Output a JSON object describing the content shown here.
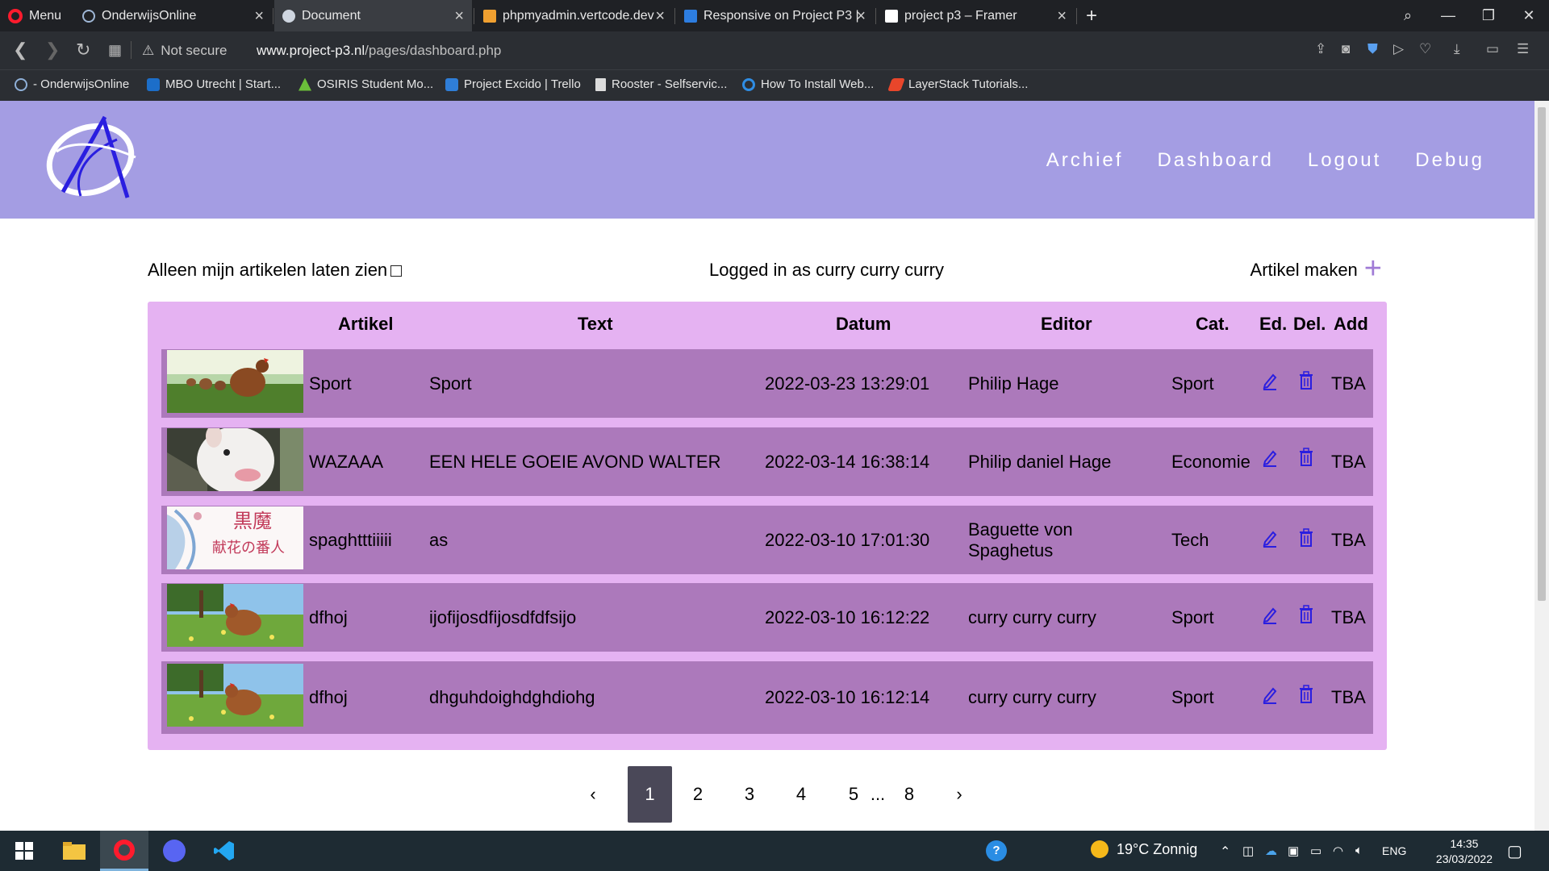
{
  "browser": {
    "menu_label": "Menu",
    "tabs": [
      {
        "title": "OnderwijsOnline",
        "favicon_color": "#9fb7d6"
      },
      {
        "title": "Document",
        "favicon_color": "#cfd6e0"
      },
      {
        "title": "phpmyadmin.vertcode.dev",
        "favicon_color": "#f0a030"
      },
      {
        "title": "Responsive on Project P3 |",
        "favicon_color": "#2d7de0"
      },
      {
        "title": "project p3 – Framer",
        "favicon_color": "#ffffff"
      }
    ],
    "new_tab": "+",
    "security_label": "Not secure",
    "url_host": "www.project-p3.nl",
    "url_path": "/pages/dashboard.php",
    "bookmarks": [
      {
        "label": "- OnderwijsOnline",
        "color": "#8fb0d8"
      },
      {
        "label": "MBO Utrecht | Start...",
        "color": "#1c6ec9"
      },
      {
        "label": "OSIRIS Student Mo...",
        "color": "#6bbf3a"
      },
      {
        "label": "Project Excido | Trello",
        "color": "#2f7ed8"
      },
      {
        "label": "Rooster - Selfservic...",
        "color": "#dcdcdc"
      },
      {
        "label": "How To Install Web...",
        "color": "#2f8de4"
      },
      {
        "label": "LayerStack Tutorials...",
        "color": "#e8462b"
      }
    ]
  },
  "site": {
    "nav": [
      "Archief",
      "Dashboard",
      "Logout",
      "Debug"
    ],
    "filter_label": "Alleen mijn artikelen laten zien",
    "logged_in": "Logged in as curry curry curry",
    "create_label": "Artikel maken",
    "create_icon": "plus-icon",
    "columns": {
      "artikel": "Artikel",
      "text": "Text",
      "datum": "Datum",
      "editor": "Editor",
      "cat": "Cat.",
      "ed": "Ed.",
      "del": "Del.",
      "add": "Add"
    },
    "rows": [
      {
        "image": "chickens-field",
        "artikel": "Sport",
        "text": "Sport",
        "datum": "2022-03-23 13:29:01",
        "editor": "Philip Hage",
        "cat": "Sport",
        "add": "TBA"
      },
      {
        "image": "bull-terrier",
        "artikel": "WAZAAA",
        "text": "EEN HELE GOEIE AVOND WALTER",
        "datum": "2022-03-14 16:38:14",
        "editor": "Philip daniel Hage",
        "cat": "Economie",
        "add": "TBA"
      },
      {
        "image": "anime-banner",
        "artikel": "spaghtttiiiii",
        "text": "as",
        "datum": "2022-03-10 17:01:30",
        "editor": "Baguette von Spaghetus",
        "cat": "Tech",
        "add": "TBA"
      },
      {
        "image": "hen-meadow",
        "artikel": "dfhoj",
        "text": "ijofijosdfijosdfdfsijo",
        "datum": "2022-03-10 16:12:22",
        "editor": "curry curry curry",
        "cat": "Sport",
        "add": "TBA"
      },
      {
        "image": "hen-meadow",
        "artikel": "dfhoj",
        "text": "dhguhdoighdghdiohg",
        "datum": "2022-03-10 16:12:14",
        "editor": "curry curry curry",
        "cat": "Sport",
        "add": "TBA"
      }
    ],
    "anime_banner_text": [
      "黒魔",
      "献花の番人"
    ],
    "pagination": {
      "prev": "‹",
      "pages": [
        "1",
        "2",
        "3",
        "4",
        "5"
      ],
      "ellipsis": "...",
      "last": "8",
      "next": "›",
      "current": "1"
    }
  },
  "taskbar": {
    "weather": "19°C  Zonnig",
    "language": "ENG",
    "time": "14:35",
    "date": "23/03/2022"
  },
  "colors": {
    "header": "#a49de3",
    "table_bg": "#e5b2f2",
    "row_bg": "#ac79bb",
    "accent_icon": "#2a1ee0",
    "pager_active": "#4a4858"
  }
}
